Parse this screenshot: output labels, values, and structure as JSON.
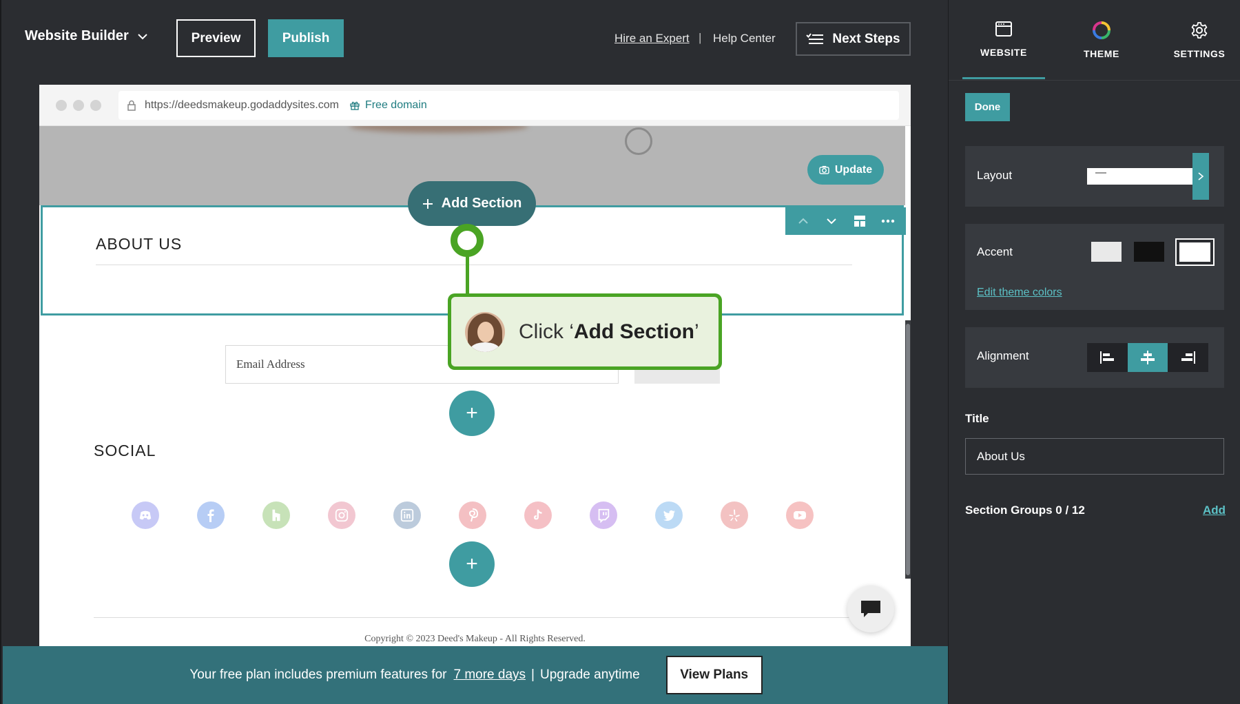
{
  "topbar": {
    "brand": "Website Builder",
    "preview": "Preview",
    "publish": "Publish",
    "hire_expert": "Hire an Expert",
    "separator": "|",
    "help_center": "Help Center",
    "next_steps": "Next Steps"
  },
  "browser": {
    "url": "https://deedsmakeup.godaddysites.com",
    "free_domain": "Free domain"
  },
  "site": {
    "update": "Update",
    "add_section": "Add Section",
    "about_title": "ABOUT US",
    "email_placeholder": "Email Address",
    "plus": "+",
    "social_title": "SOCIAL",
    "social_icons": [
      "discord-icon",
      "facebook-icon",
      "houzz-icon",
      "instagram-icon",
      "linkedin-icon",
      "pinterest-icon",
      "tiktok-icon",
      "twitch-icon",
      "twitter-icon",
      "yelp-icon",
      "youtube-icon"
    ],
    "copyright": "Copyright © 2023 Deed's Makeup - All Rights Reserved."
  },
  "callout": {
    "prefix": "Click ‘",
    "bold": "Add Section",
    "suffix": "’"
  },
  "banner": {
    "text": "Your free plan includes premium features for",
    "link": "7 more days",
    "separator": "|",
    "upgrade": "Upgrade anytime",
    "view_plans": "View Plans"
  },
  "panel": {
    "tabs": [
      {
        "label": "WEBSITE",
        "icon": "browser-window-icon",
        "active": true
      },
      {
        "label": "THEME",
        "icon": "color-wheel-icon",
        "active": false
      },
      {
        "label": "SETTINGS",
        "icon": "gear-icon",
        "active": false
      }
    ],
    "done": "Done",
    "layout_label": "Layout",
    "accent_label": "Accent",
    "edit_theme_colors": "Edit theme colors",
    "alignment_label": "Alignment",
    "alignment_selected": "center",
    "title_label": "Title",
    "title_value": "About Us",
    "section_groups": "Section Groups 0 / 12",
    "add": "Add"
  },
  "colors": {
    "accent": "#3f9ca1",
    "callout_green": "#4aa424",
    "banner": "#33717a"
  }
}
